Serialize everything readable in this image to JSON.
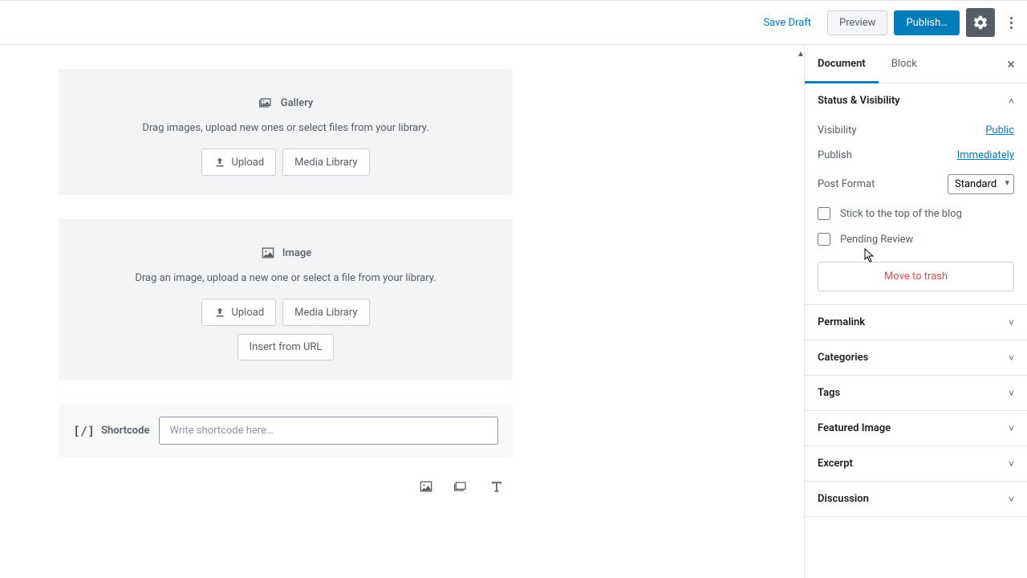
{
  "toolbar": {
    "save_draft": "Save Draft",
    "preview": "Preview",
    "publish": "Publish…"
  },
  "blocks": {
    "gallery": {
      "title": "Gallery",
      "instruction": "Drag images, upload new ones or select files from your library.",
      "upload": "Upload",
      "media_library": "Media Library"
    },
    "image": {
      "title": "Image",
      "instruction": "Drag an image, upload a new one or select a file from your library.",
      "upload": "Upload",
      "media_library": "Media Library",
      "insert_url": "Insert from URL"
    },
    "shortcode": {
      "label": "Shortcode",
      "icon": "[/]",
      "placeholder": "Write shortcode here…"
    }
  },
  "sidebar": {
    "tabs": {
      "document": "Document",
      "block": "Block"
    },
    "status": {
      "title": "Status & Visibility",
      "visibility_label": "Visibility",
      "visibility_value": "Public",
      "publish_label": "Publish",
      "publish_value": "Immediately",
      "format_label": "Post Format",
      "format_value": "Standard",
      "stick": "Stick to the top of the blog",
      "pending": "Pending Review",
      "trash": "Move to trash"
    },
    "panels": {
      "permalink": "Permalink",
      "categories": "Categories",
      "tags": "Tags",
      "featured_image": "Featured Image",
      "excerpt": "Excerpt",
      "discussion": "Discussion"
    }
  }
}
